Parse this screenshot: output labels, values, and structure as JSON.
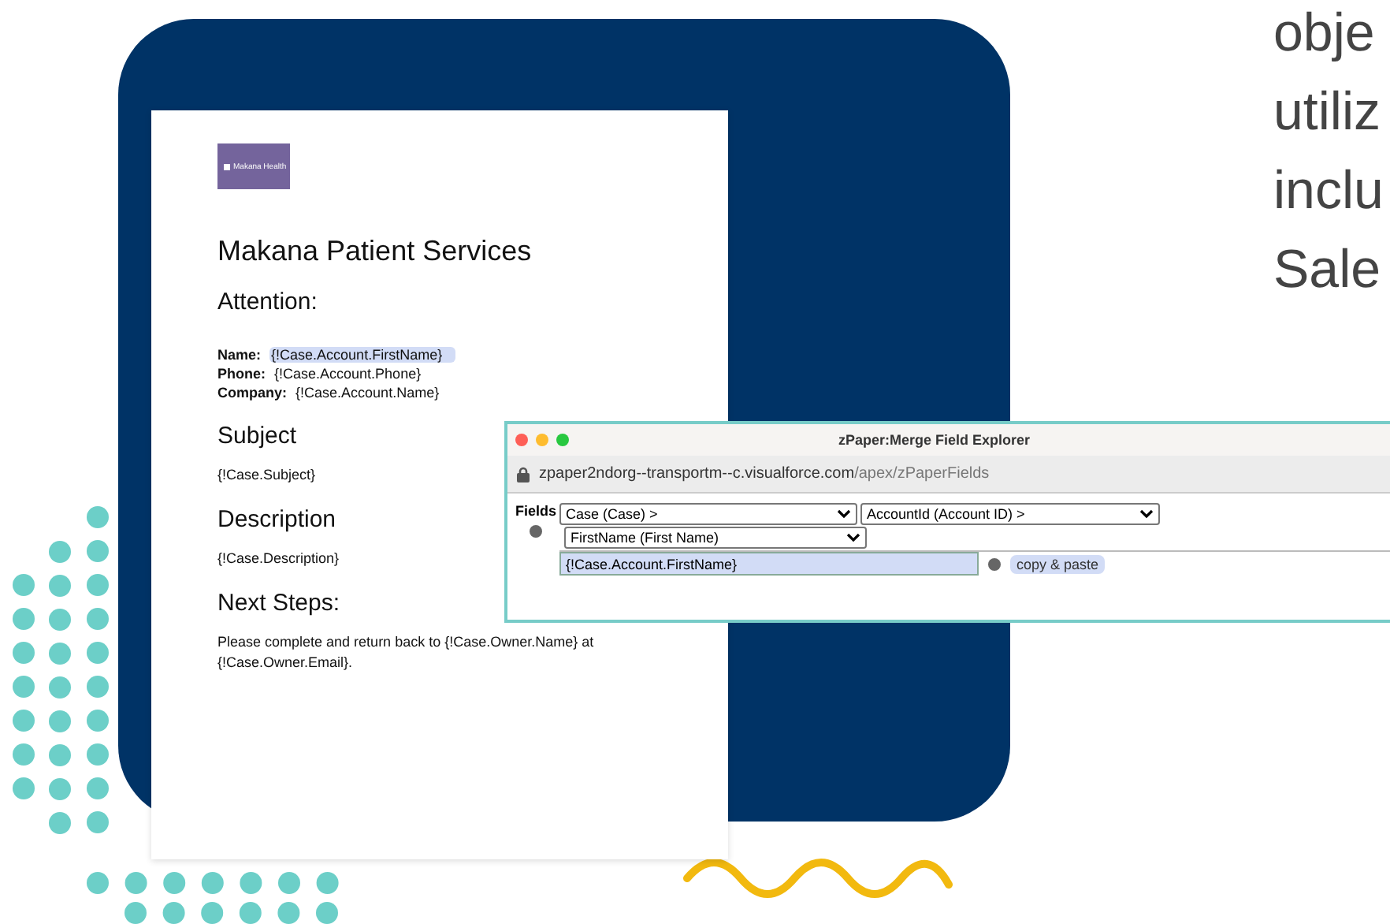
{
  "document": {
    "logo_text": "Makana Health",
    "title": "Makana Patient Services",
    "sections": [
      {
        "heading": "Attention:",
        "kind": "fields",
        "fields": [
          {
            "label": "Name:",
            "value": "{!Case.Account.FirstName}",
            "highlighted": true
          },
          {
            "label": "Phone:",
            "value": "{!Case.Account.Phone}",
            "highlighted": false
          },
          {
            "label": "Company:",
            "value": "{!Case.Account.Name}",
            "highlighted": false
          }
        ]
      },
      {
        "heading": "Subject",
        "kind": "text",
        "body": "{!Case.Subject}"
      },
      {
        "heading": "Description",
        "kind": "text",
        "body": "{!Case.Description}"
      },
      {
        "heading": "Next Steps:",
        "kind": "text",
        "body": "Please complete and return back to {!Case.Owner.Name} at {!Case.Owner.Email}."
      }
    ]
  },
  "window": {
    "title": "zPaper:Merge Field Explorer",
    "url_host": "zpaper2ndorg--transportm--c.visualforce.com",
    "url_path": "/apex/zPaperFields",
    "fields_label": "Fields",
    "selects": [
      "Case (Case) >",
      "AccountId (Account ID) >"
    ],
    "sub_select": "FirstName (First Name)",
    "merge_field": "{!Case.Account.FirstName}",
    "hint": "copy & paste"
  },
  "side_text": [
    "obje",
    "utiliz",
    "inclu",
    "Sale"
  ]
}
